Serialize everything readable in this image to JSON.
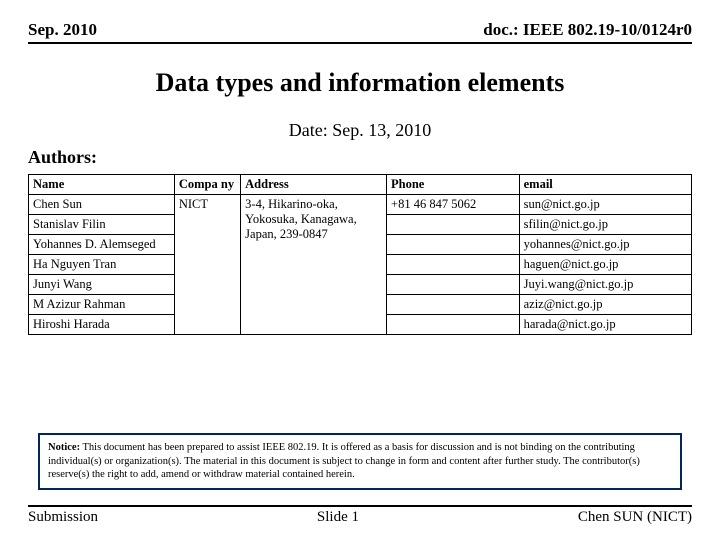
{
  "header": {
    "left": "Sep. 2010",
    "right": "doc.: IEEE 802.19-10/0124r0"
  },
  "title": "Data types and information elements",
  "date_line": "Date: Sep. 13, 2010",
  "authors_label": "Authors:",
  "table": {
    "headers": {
      "name": "Name",
      "company": "Compa ny",
      "address": "Address",
      "phone": "Phone",
      "email": "email"
    },
    "company": "NICT",
    "address": "3-4, Hikarino-oka, Yokosuka, Kanagawa, Japan, 239-0847",
    "rows": [
      {
        "name": "Chen Sun",
        "phone": "+81 46 847 5062",
        "email": "sun@nict.go.jp"
      },
      {
        "name": "Stanislav Filin",
        "phone": "",
        "email": "sfilin@nict.go.jp"
      },
      {
        "name": "Yohannes D. Alemseged",
        "phone": "",
        "email": "yohannes@nict.go.jp"
      },
      {
        "name": "Ha Nguyen Tran",
        "phone": "",
        "email": "haguen@nict.go.jp"
      },
      {
        "name": "Junyi Wang",
        "phone": "",
        "email": "Juyi.wang@nict.go.jp"
      },
      {
        "name": "M Azizur Rahman",
        "phone": "",
        "email": "aziz@nict.go.jp"
      },
      {
        "name": "Hiroshi Harada",
        "phone": "",
        "email": "harada@nict.go.jp"
      }
    ]
  },
  "notice": {
    "lead": "Notice:",
    "body": " This document has been prepared to assist IEEE 802.19. It is offered as a basis for discussion and is not binding on the contributing individual(s) or organization(s). The material in this document is subject to change in form and content after further study. The contributor(s) reserve(s) the right to add, amend or withdraw material contained herein."
  },
  "footer": {
    "left": "Submission",
    "center": "Slide 1",
    "right": "Chen SUN (NICT)"
  }
}
